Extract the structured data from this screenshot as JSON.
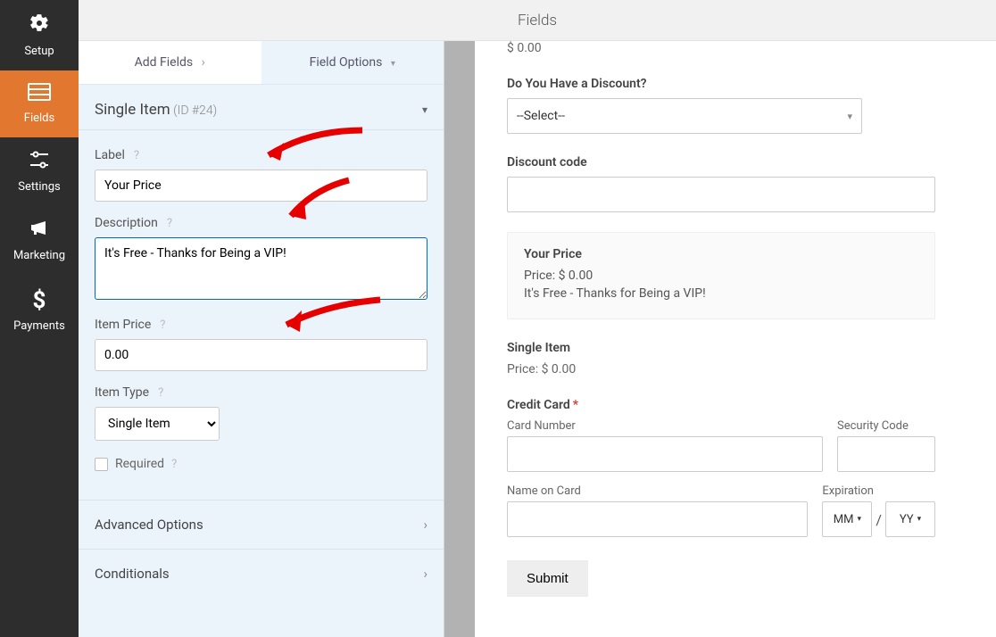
{
  "nav": {
    "items": [
      {
        "icon": "gear-icon",
        "glyph": "⚙",
        "label": "Setup"
      },
      {
        "icon": "fields-icon",
        "glyph": "☰",
        "label": "Fields"
      },
      {
        "icon": "sliders-icon",
        "glyph": "⚙",
        "label": "Settings"
      },
      {
        "icon": "bullhorn-icon",
        "glyph": "📣",
        "label": "Marketing"
      },
      {
        "icon": "dollar-icon",
        "glyph": "$",
        "label": "Payments"
      }
    ],
    "active_index": 1
  },
  "header": {
    "title": "Fields"
  },
  "tabs": {
    "add_fields": "Add Fields",
    "field_options": "Field Options"
  },
  "field": {
    "title": "Single Item",
    "id_label": "(ID #24)"
  },
  "labels": {
    "label": "Label",
    "description": "Description",
    "item_price": "Item Price",
    "item_type": "Item Type",
    "required": "Required",
    "advanced": "Advanced Options",
    "conditionals": "Conditionals"
  },
  "values": {
    "label": "Your Price",
    "description": "It's Free - Thanks for Being a VIP!",
    "item_price": "0.00",
    "item_type": "Single Item"
  },
  "preview": {
    "top_price": "$ 0.00",
    "discount_q": "Do You Have a Discount?",
    "select_placeholder": "--Select--",
    "discount_code": "Discount code",
    "your_price": "Your Price",
    "price_line": "Price: $ 0.00",
    "desc_line": "It's Free - Thanks for Being a VIP!",
    "single_item": "Single Item",
    "single_price": "Price: $ 0.00",
    "credit_card": "Credit Card",
    "card_number": "Card Number",
    "security_code": "Security Code",
    "name_on_card": "Name on Card",
    "expiration": "Expiration",
    "mm": "MM",
    "yy": "YY",
    "submit": "Submit"
  }
}
